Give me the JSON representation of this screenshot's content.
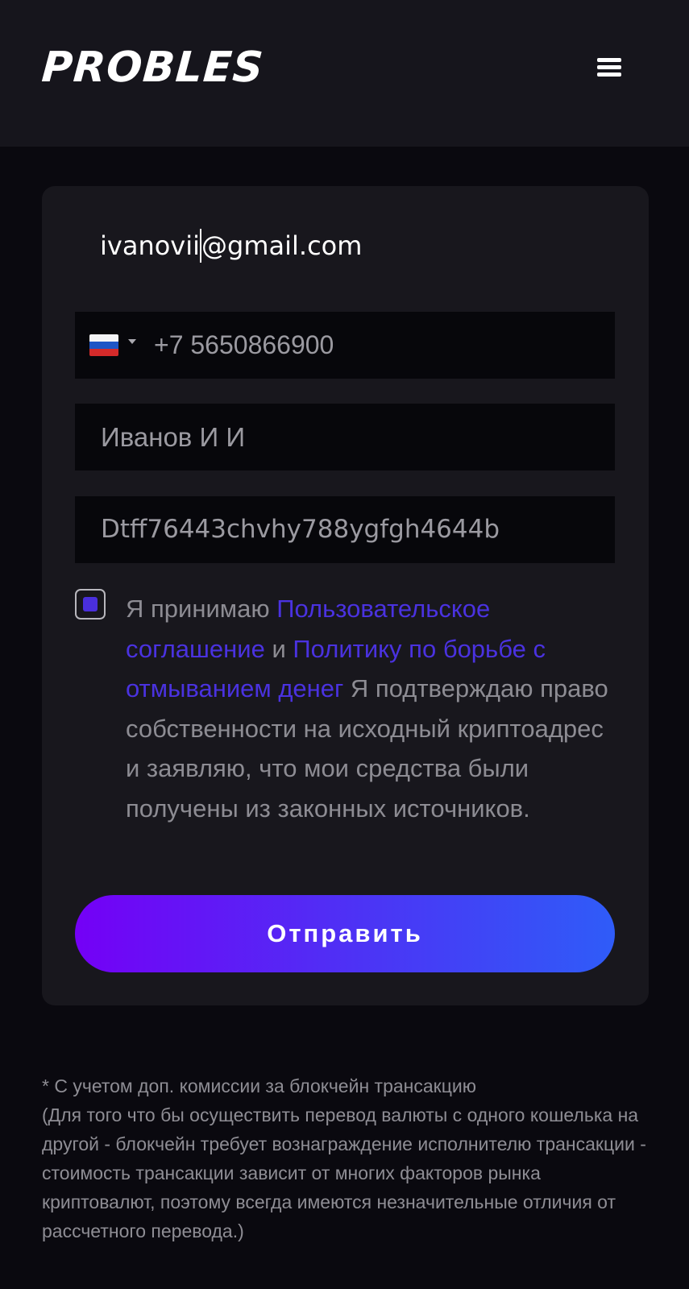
{
  "header": {
    "logo": "PROBLES",
    "menu_icon": "hamburger-menu-icon"
  },
  "form": {
    "email_value_before_caret": "ivanovii",
    "email_value_after_caret": "@gmail.com",
    "phone": {
      "country_flag": "russia-flag-icon",
      "value": "+7 5650866900"
    },
    "name_value": "Иванов И И",
    "wallet_value": "Dtff76443chvhy788ygfgh4644b",
    "agreement": {
      "checked": true,
      "text_1": "Я принимаю ",
      "link_1": "Пользовательское соглашение",
      "text_2": " и ",
      "link_2": "Политику по борьбе с отмыванием денег",
      "text_3": " Я подтверждаю право собственности на исходный криптоадрес и заявляю, что мои средства были получены из законных источников."
    },
    "submit_label": "Отправить"
  },
  "footnote": {
    "line_1": "* С учетом доп. комиссии за блокчейн трансакцию",
    "line_2": "(Для того что бы осуществить перевод валюты с одного кошелька на другой - блокчейн требует вознаграждение исполнителю трансакции - стоимость трансакции зависит от многих факторов рынка криптовалют, поэтому всегда имеются незначительные отличия от рассчетного перевода.)"
  },
  "colors": {
    "accent": "#4a32e0",
    "button_gradient_start": "#7400f6",
    "button_gradient_end": "#2f5cf8",
    "background": "#0a090f",
    "card": "#18171d"
  }
}
